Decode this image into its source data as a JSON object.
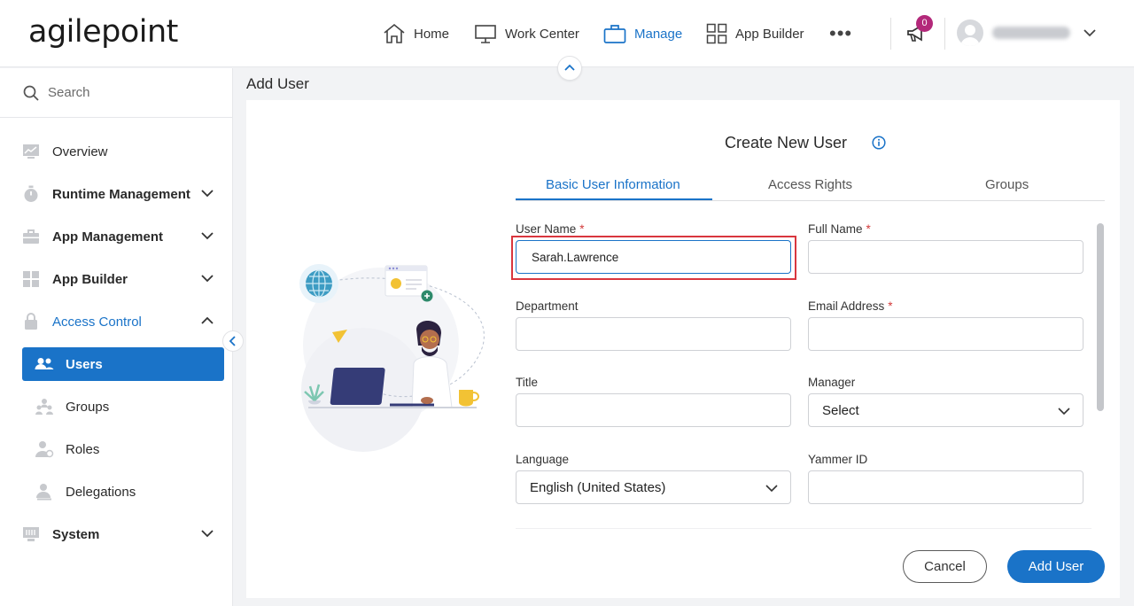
{
  "brand": {
    "logo": "agilepoint",
    "accent": "#1a73c8"
  },
  "topnav": {
    "items": [
      {
        "label": "Home",
        "icon": "home-icon"
      },
      {
        "label": "Work Center",
        "icon": "monitor-icon"
      },
      {
        "label": "Manage",
        "icon": "briefcase-icon",
        "active": true
      },
      {
        "label": "App Builder",
        "icon": "grid-icon"
      }
    ],
    "more": "•••",
    "notifications_count": "0"
  },
  "sidebar": {
    "search_placeholder": "Search",
    "items": [
      {
        "label": "Overview",
        "icon": "chart-icon"
      },
      {
        "label": "Runtime Management",
        "icon": "stopwatch-icon",
        "expandable": true
      },
      {
        "label": "App Management",
        "icon": "toolbox-icon",
        "expandable": true
      },
      {
        "label": "App Builder",
        "icon": "apps-icon",
        "expandable": true
      },
      {
        "label": "Access Control",
        "icon": "lock-icon",
        "expandable": true,
        "expanded": true
      },
      {
        "label": "System",
        "icon": "server-icon",
        "expandable": true
      }
    ],
    "subitems": [
      {
        "label": "Users",
        "icon": "users-icon",
        "active": true
      },
      {
        "label": "Groups",
        "icon": "groups-icon"
      },
      {
        "label": "Roles",
        "icon": "roles-icon"
      },
      {
        "label": "Delegations",
        "icon": "delegations-icon"
      }
    ]
  },
  "page": {
    "title": "Add User"
  },
  "form": {
    "title": "Create New User",
    "tabs": [
      "Basic User Information",
      "Access Rights",
      "Groups"
    ],
    "fields": {
      "user_name": {
        "label": "User Name",
        "value": "Sarah.Lawrence",
        "required": "*"
      },
      "full_name": {
        "label": "Full Name",
        "value": "",
        "required": "*"
      },
      "department": {
        "label": "Department",
        "value": ""
      },
      "email": {
        "label": "Email Address",
        "value": "",
        "required": "*"
      },
      "title": {
        "label": "Title",
        "value": ""
      },
      "manager": {
        "label": "Manager",
        "value": "Select"
      },
      "language": {
        "label": "Language",
        "value": "English (United States)"
      },
      "yammer": {
        "label": "Yammer ID",
        "value": ""
      }
    },
    "buttons": {
      "cancel": "Cancel",
      "add": "Add User"
    }
  }
}
